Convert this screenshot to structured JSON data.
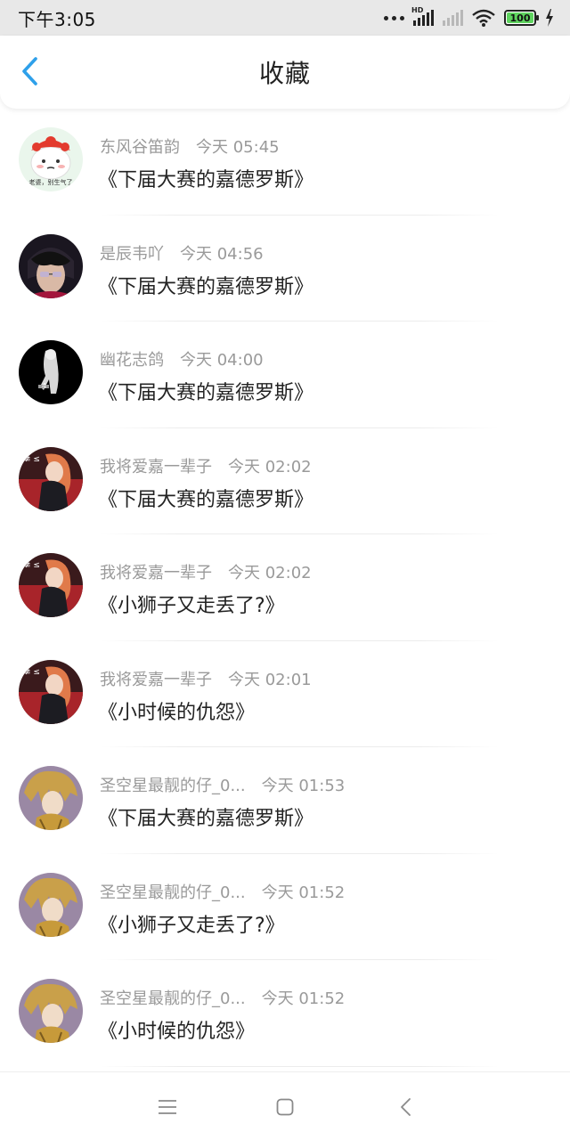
{
  "status_bar": {
    "time": "下午3:05",
    "battery": "100",
    "battery_level": 1.0,
    "network_badge": "HD"
  },
  "header": {
    "title": "收藏",
    "back_icon": "chevron-left-icon",
    "accent_color": "#2ea0ea"
  },
  "favorites": [
    {
      "author": "东风谷笛韵",
      "time": "今天 05:45",
      "title": "《下届大赛的嘉德罗斯》"
    },
    {
      "author": "是辰韦吖",
      "time": "今天 04:56",
      "title": "《下届大赛的嘉德罗斯》"
    },
    {
      "author": "幽花志鸽",
      "time": "今天 04:00",
      "title": "《下届大赛的嘉德罗斯》"
    },
    {
      "author": "我将爱嘉一辈子",
      "time": "今天 02:02",
      "title": "《下届大赛的嘉德罗斯》"
    },
    {
      "author": "我将爱嘉一辈子",
      "time": "今天 02:02",
      "title": "《小狮子又走丢了?》"
    },
    {
      "author": "我将爱嘉一辈子",
      "time": "今天 02:01",
      "title": "《小时候的仇怨》"
    },
    {
      "author": "圣空星最靓的仔_0...",
      "time": "今天 01:53",
      "title": "《下届大赛的嘉德罗斯》"
    },
    {
      "author": "圣空星最靓的仔_0...",
      "time": "今天 01:52",
      "title": "《小狮子又走丢了?》"
    },
    {
      "author": "圣空星最靓的仔_0...",
      "time": "今天 01:52",
      "title": "《小时候的仇怨》"
    }
  ],
  "avatar_texts": {
    "first": "老婆，别生气了"
  },
  "nav_bar": {
    "menu_icon": "menu-icon",
    "home_icon": "home-square-icon",
    "back_icon": "back-triangle-icon"
  }
}
